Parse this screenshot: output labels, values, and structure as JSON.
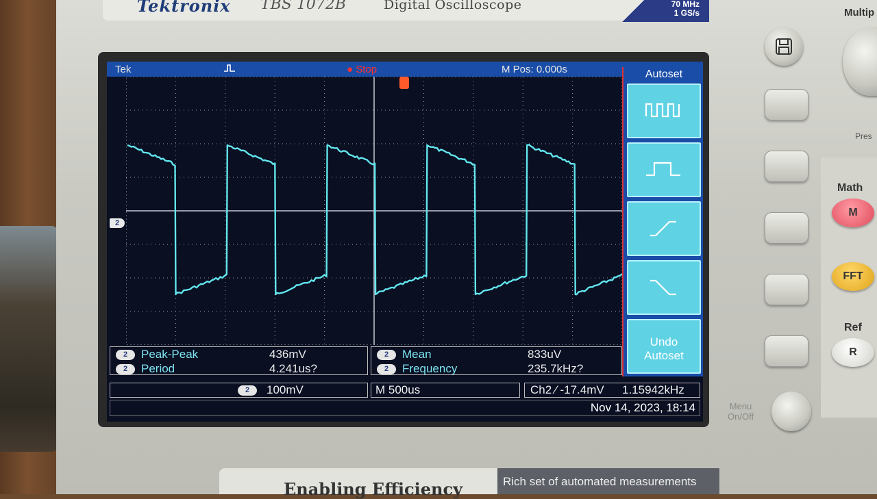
{
  "device": {
    "brand": "Tektronix",
    "model": "TBS 1072B",
    "description": "Digital Oscilloscope",
    "spec_line1": "70 MHz",
    "spec_line2": "1 GS/s",
    "multi_label": "Multip",
    "press_label": "Pres",
    "math_label": "Math",
    "math_button": "M",
    "fft_button": "FFT",
    "ref_label": "Ref",
    "ref_button": "R",
    "menu_onoff_line1": "Menu",
    "menu_onoff_line2": "On/Off",
    "footer_slogan": "Enabling Efficiency",
    "footer_banner": "Rich set of automated measurements"
  },
  "status_bar": {
    "brand": "Tek",
    "acquisition_state": "Stop",
    "position": "M Pos: 0.000s"
  },
  "side_menu": {
    "title": "Autoset",
    "options": [
      {
        "icon": "multi-cycle-square-wave-icon"
      },
      {
        "icon": "single-cycle-pulse-icon"
      },
      {
        "icon": "rising-edge-icon"
      },
      {
        "icon": "falling-edge-icon"
      }
    ],
    "undo_line1": "Undo",
    "undo_line2": "Autoset"
  },
  "measurements": [
    {
      "channel": "2",
      "label": "Peak-Peak",
      "value": "436mV"
    },
    {
      "channel": "2",
      "label": "Period",
      "value": "4.241us?"
    },
    {
      "channel": "2",
      "label": "Mean",
      "value": "833uV"
    },
    {
      "channel": "2",
      "label": "Frequency",
      "value": "235.7kHz?"
    }
  ],
  "settings": {
    "channel": "2",
    "volts_per_div": "100mV",
    "time_per_div": "M 500us",
    "trigger": "Ch2 ⁄ -17.4mV",
    "trigger_frequency": "1.15942kHz"
  },
  "datetime": "Nov 14, 2023, 18:14",
  "marker": {
    "channel_ground": "2"
  },
  "colors": {
    "trace": "#62e6ee",
    "status_bar": "#1a4da8",
    "menu_button": "#5fd2e4",
    "stop_text": "#ff3030",
    "trigger_marker": "#ff5a2a"
  }
}
